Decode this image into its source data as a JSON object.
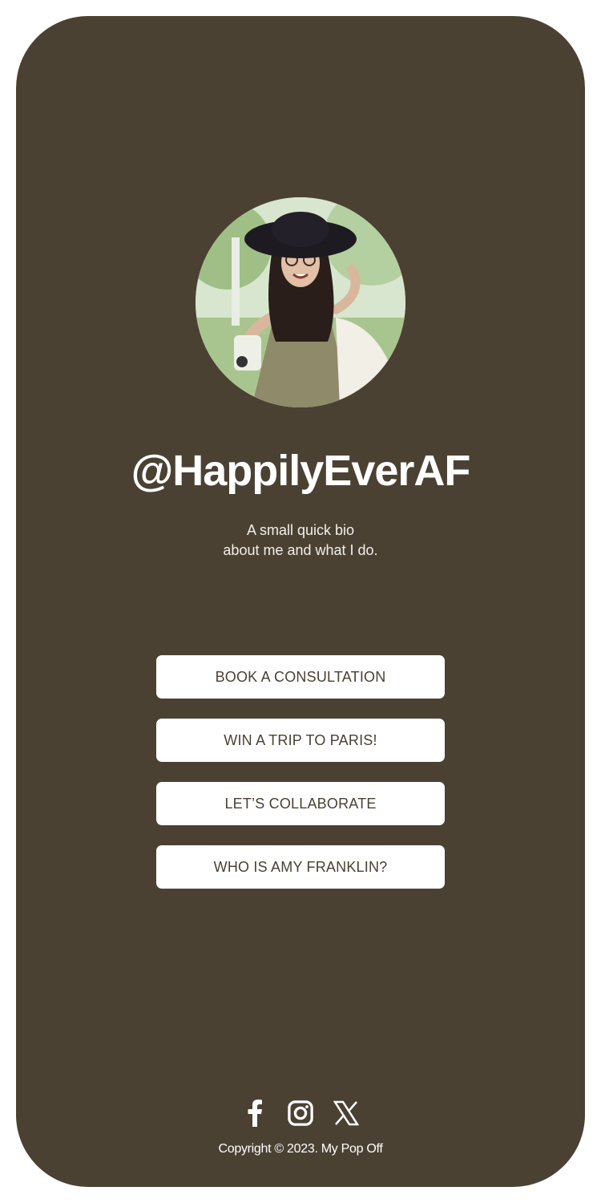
{
  "profile": {
    "handle": "@HappilyEverAF",
    "bio_line1": "A small quick bio",
    "bio_line2": "about me and what I do."
  },
  "links": [
    {
      "label": "BOOK A CONSULTATION"
    },
    {
      "label": "WIN A TRIP TO PARIS!"
    },
    {
      "label": "LET’S COLLABORATE"
    },
    {
      "label": "WHO IS AMY FRANKLIN?"
    }
  ],
  "socials": [
    {
      "icon": "facebook-icon"
    },
    {
      "icon": "instagram-icon"
    },
    {
      "icon": "x-icon"
    }
  ],
  "footer": {
    "copyright": "Copyright © 2023. My Pop Off"
  },
  "colors": {
    "background": "#4b4133",
    "button_bg": "#ffffff",
    "button_text": "#4b4133",
    "text": "#ffffff"
  }
}
